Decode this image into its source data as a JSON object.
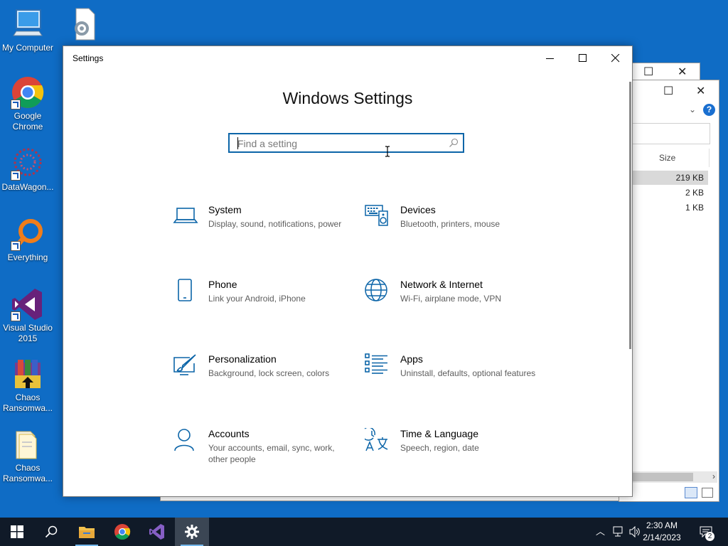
{
  "desktop": {
    "icons": [
      {
        "label": "My Computer"
      },
      {
        "label": "Google\nChrome"
      },
      {
        "label": "DataWagon..."
      },
      {
        "label": "Everything"
      },
      {
        "label": "Visual Studio\n2015"
      },
      {
        "label": "Chaos\nRansomwa..."
      },
      {
        "label": "Chaos\nRansomwa..."
      }
    ]
  },
  "background_window": {
    "column_header": "Size",
    "rows": [
      "219 KB",
      "2 KB",
      "1 KB"
    ]
  },
  "settings": {
    "window_title": "Settings",
    "heading": "Windows Settings",
    "search_placeholder": "Find a setting",
    "categories": [
      {
        "name": "System",
        "desc": "Display, sound, notifications, power",
        "icon": "laptop-icon"
      },
      {
        "name": "Devices",
        "desc": "Bluetooth, printers, mouse",
        "icon": "keyboard-speaker-icon"
      },
      {
        "name": "Phone",
        "desc": "Link your Android, iPhone",
        "icon": "phone-icon"
      },
      {
        "name": "Network & Internet",
        "desc": "Wi-Fi, airplane mode, VPN",
        "icon": "globe-icon"
      },
      {
        "name": "Personalization",
        "desc": "Background, lock screen, colors",
        "icon": "paint-icon"
      },
      {
        "name": "Apps",
        "desc": "Uninstall, defaults, optional features",
        "icon": "apps-list-icon"
      },
      {
        "name": "Accounts",
        "desc": "Your accounts, email, sync, work, other people",
        "icon": "person-icon"
      },
      {
        "name": "Time & Language",
        "desc": "Speech, region, date",
        "icon": "time-language-icon"
      }
    ]
  },
  "taskbar": {
    "time": "2:30 AM",
    "date": "2/14/2023",
    "notification_count": "2"
  },
  "colors": {
    "desktop": "#0f6cc5",
    "accent": "#0c65a8",
    "taskbar": "#101a28"
  }
}
